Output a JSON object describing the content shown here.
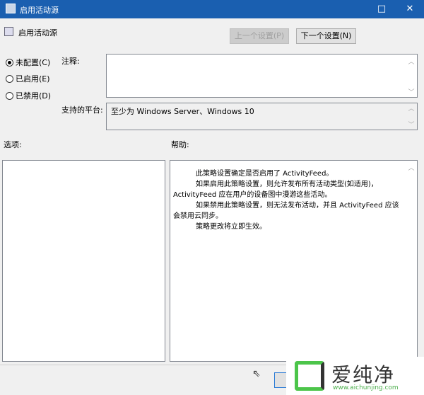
{
  "window": {
    "title": "启用活动源",
    "maximize_icon": "□",
    "close_icon": "✕"
  },
  "header": {
    "title": "启用活动源",
    "prev_label": "上一个设置(P)",
    "next_label": "下一个设置(N)"
  },
  "radios": [
    {
      "label": "未配置(C)",
      "checked": true
    },
    {
      "label": "已启用(E)",
      "checked": false
    },
    {
      "label": "已禁用(D)",
      "checked": false
    }
  ],
  "comment": {
    "label": "注释:",
    "value": ""
  },
  "platform": {
    "label": "支持的平台:",
    "value": "至少为 Windows Server、Windows 10"
  },
  "options_label": "选项:",
  "help_label": "帮助:",
  "help_text": [
    "此策略设置确定是否启用了 ActivityFeed。",
    "如果启用此策略设置，则允许发布所有活动类型(如适用)，ActivityFeed 应在用户的设备图中漫游这些活动。",
    "如果禁用此策略设置，则无法发布活动，并且 ActivityFeed 应该会禁用云同步。",
    "策略更改将立即生效。"
  ],
  "watermark": {
    "name": "爱纯净",
    "url": "www.aichunjing.com"
  }
}
